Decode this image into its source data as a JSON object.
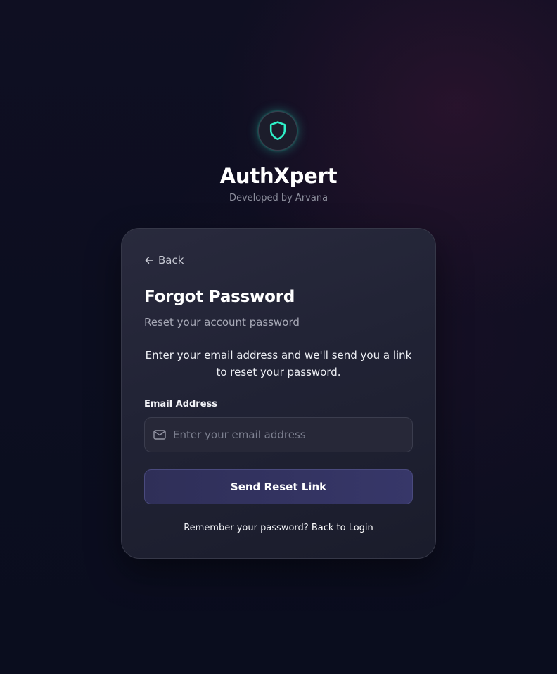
{
  "brand": {
    "name": "AuthXpert",
    "tagline": "Developed by Arvana",
    "logo_icon": "shield-icon",
    "accent_color": "#2ef0c8"
  },
  "card": {
    "back_label": "Back",
    "back_icon": "arrow-left-icon",
    "title": "Forgot Password",
    "subtitle": "Reset your account password",
    "info": "Enter your email address and we'll send you a link to reset your password.",
    "email": {
      "label": "Email Address",
      "icon": "mail-icon",
      "value": "",
      "placeholder": "Enter your email address"
    },
    "submit_label": "Send Reset Link",
    "footer": {
      "prompt": "Remember your password?",
      "link": "Back to Login"
    }
  },
  "colors": {
    "background": "#0b0d1d",
    "card": "#232437",
    "button": "#33335f"
  }
}
